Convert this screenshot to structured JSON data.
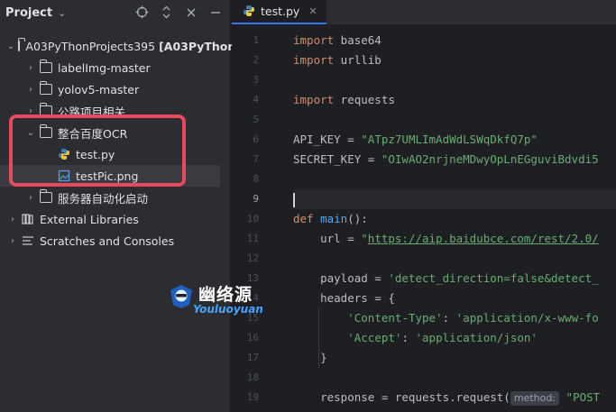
{
  "project": {
    "title": "Project",
    "items": [
      {
        "label": "A03PyThonProjects395",
        "suffix": "[A03PyThon"
      },
      {
        "label": "labelImg-master"
      },
      {
        "label": "yolov5-master"
      },
      {
        "label": "公路项目相关"
      },
      {
        "label": "整合百度OCR"
      },
      {
        "label": "test.py"
      },
      {
        "label": "testPic.png"
      },
      {
        "label": "服务器自动化启动"
      },
      {
        "label": "External Libraries"
      },
      {
        "label": "Scratches and Consoles"
      }
    ]
  },
  "editor": {
    "tab": "test.py",
    "lines": {
      "l1_kw": "import",
      "l1_mod": " base64",
      "l2_kw": "import",
      "l2_mod": " urllib",
      "l4_kw": "import",
      "l4_mod": " requests",
      "l6_name": "API_KEY = ",
      "l6_val": "\"ATpz7UMLImAdWdLSWqDkfQ7p\"",
      "l7_name": "SECRET_KEY = ",
      "l7_val": "\"OIwAO2nrjneMDwyOpLnEGguviBdvdi5",
      "l10_kw": "def",
      "l10_fn": "main",
      "l10_rest": "():",
      "l11_a": "    url = ",
      "l11_q": "\"",
      "l11_url": "https://aip.baidubce.com/rest/2.0/",
      "l13_a": "    payload = ",
      "l13_s": "'detect_direction=false&detect_",
      "l14_a": "    headers = {",
      "l15_k": "'Content-Type'",
      "l15_sep": ": ",
      "l15_v": "'application/x-www-fo",
      "l16_k": "'Accept'",
      "l16_sep": ": ",
      "l16_v": "'application/json'",
      "l17_a": "    }",
      "l19_a": "    response = requests.request(",
      "l19_hint": "method:",
      "l19_s": " \"POST"
    },
    "line_numbers": [
      "1",
      "2",
      "3",
      "4",
      "5",
      "6",
      "7",
      "8",
      "9",
      "10",
      "11",
      "12",
      "13",
      "14",
      "15",
      "16",
      "17",
      "18",
      "19"
    ]
  },
  "watermark": {
    "cn": "幽络源",
    "en": "Youluoyuan"
  },
  "colors": {
    "accent": "#3574f0",
    "highlight": "#e8495f"
  }
}
